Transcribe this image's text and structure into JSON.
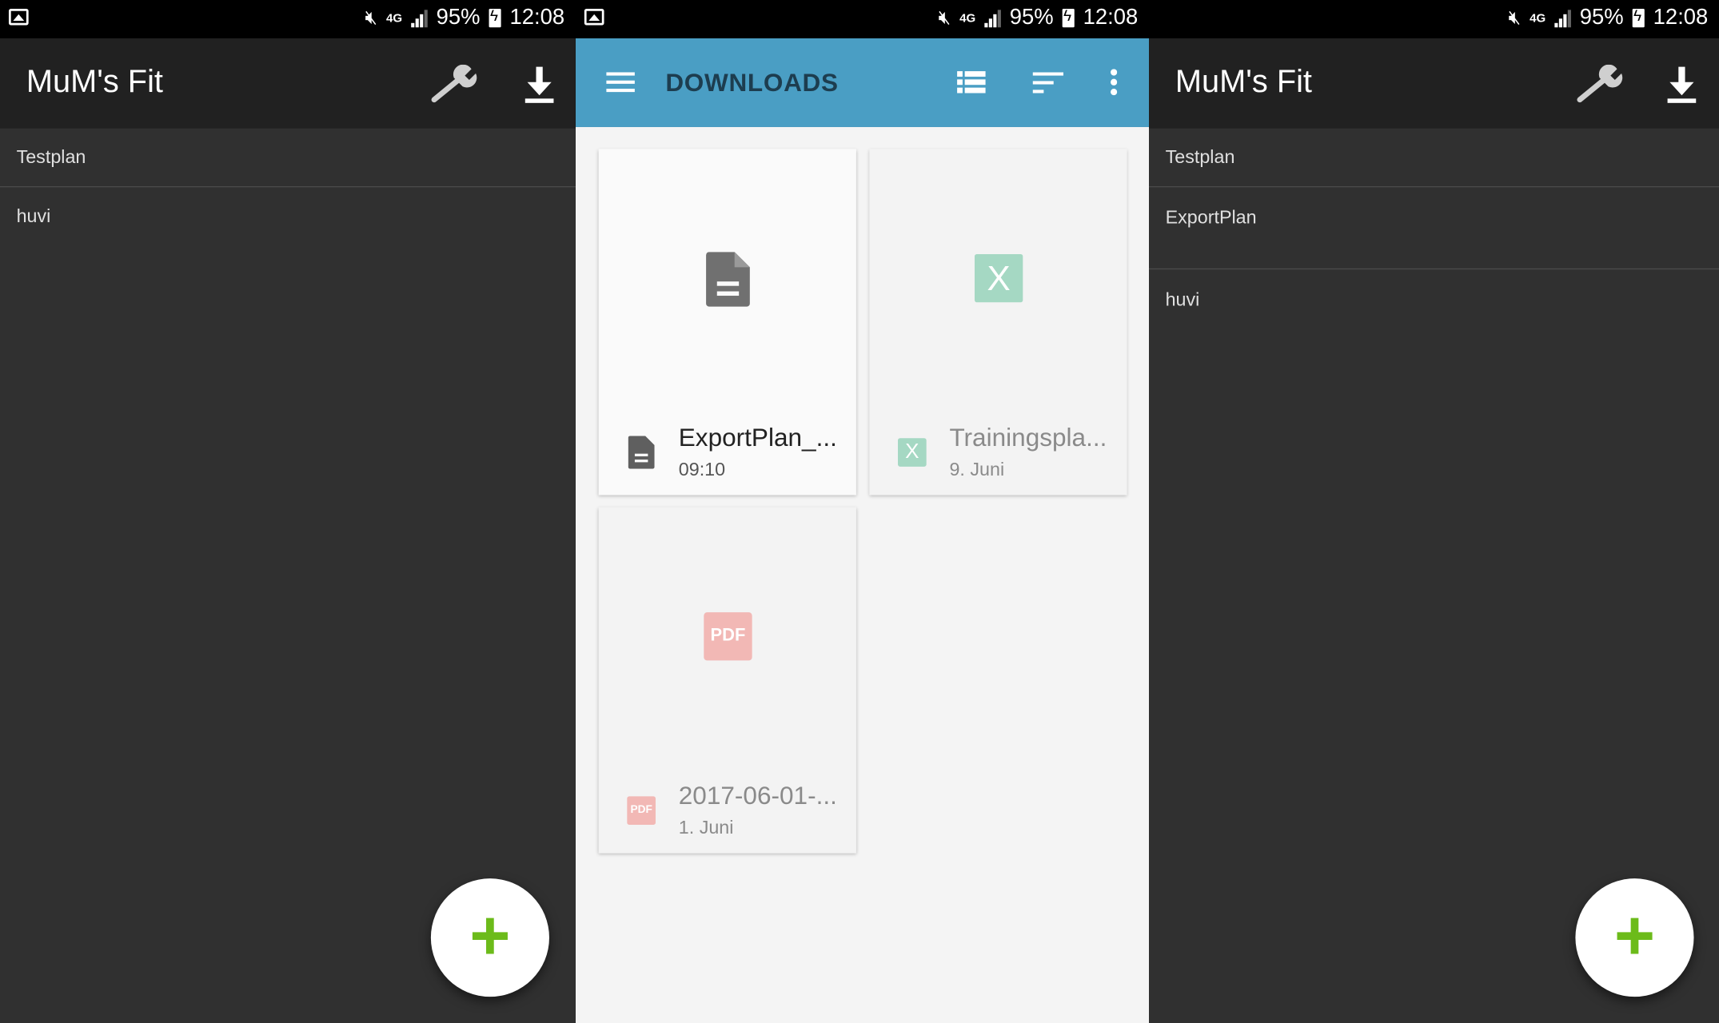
{
  "status_bar": {
    "battery": "95%",
    "time": "12:08",
    "network": "4G"
  },
  "left_phone": {
    "title": "MuM's Fit",
    "items": [
      "Testplan",
      "huvi"
    ],
    "fab_label": "+"
  },
  "middle_phone": {
    "title": "DOWNLOADS",
    "files": [
      {
        "name": "ExportPlan_...",
        "date": "09:10",
        "type": "doc"
      },
      {
        "name": "Trainingspla...",
        "date": "9. Juni",
        "type": "excel",
        "icon_label": "X"
      },
      {
        "name": "2017-06-01-...",
        "date": "1. Juni",
        "type": "pdf",
        "icon_label": "PDF"
      }
    ]
  },
  "right_phone": {
    "title": "MuM's Fit",
    "items": [
      "Testplan",
      "ExportPlan",
      "huvi"
    ],
    "fab_label": "+"
  },
  "colors": {
    "dark_appbar": "#212121",
    "dark_bg": "#303030",
    "downloads_appbar": "#4a9ec4",
    "fab_plus": "#6cbb1a",
    "excel": "#a5d8c3",
    "pdf": "#f2b8b5"
  },
  "icons": [
    "image-icon",
    "mute-icon",
    "signal-icon",
    "battery-icon",
    "wrench-icon",
    "download-icon",
    "menu-icon",
    "list-view-icon",
    "sort-icon",
    "more-vert-icon",
    "document-icon",
    "excel-icon",
    "pdf-icon",
    "add-icon"
  ]
}
